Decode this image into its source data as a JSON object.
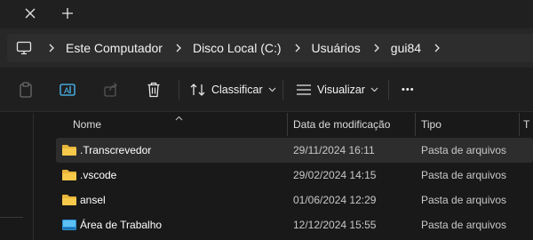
{
  "window": {
    "close_tab_glyph": "✕",
    "new_tab_glyph": "+"
  },
  "breadcrumb": {
    "items": [
      "Este Computador",
      "Disco Local (C:)",
      "Usuários",
      "gui84"
    ]
  },
  "commandbar": {
    "sort_label": "Classificar",
    "view_label": "Visualizar",
    "more_glyph": "•••"
  },
  "columns": {
    "name": "Nome",
    "date": "Data de modificação",
    "type": "Tipo",
    "size": "T"
  },
  "files": [
    {
      "name": ".Transcrevedor",
      "date": "29/11/2024 16:11",
      "type": "Pasta de arquivos",
      "icon": "folder-icon",
      "selected": true
    },
    {
      "name": ".vscode",
      "date": "29/02/2024 14:15",
      "type": "Pasta de arquivos",
      "icon": "folder-icon",
      "selected": false
    },
    {
      "name": "ansel",
      "date": "01/06/2024 12:29",
      "type": "Pasta de arquivos",
      "icon": "folder-icon",
      "selected": false
    },
    {
      "name": "Área de Trabalho",
      "date": "12/12/2024 15:55",
      "type": "Pasta de arquivos",
      "icon": "desktop-folder-icon",
      "selected": false
    }
  ],
  "colors": {
    "folder": "#f6c94a",
    "desktop_folder": "#3aa0e6",
    "accent": "#4cc2ff"
  }
}
